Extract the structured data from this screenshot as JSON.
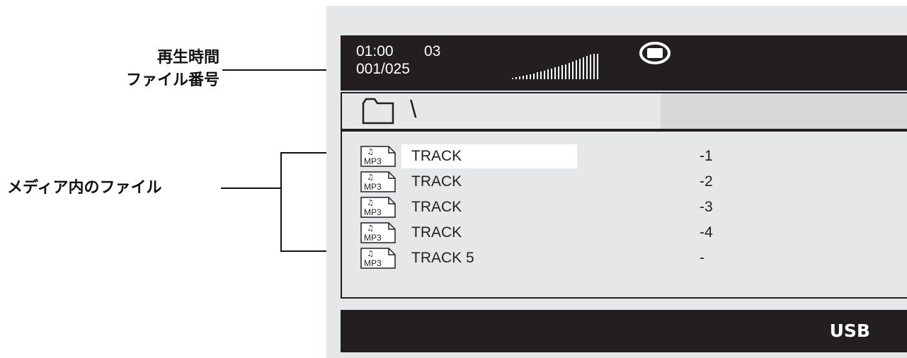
{
  "callouts": {
    "time_label": "再生時間",
    "file_number_label": "ファイル番号",
    "media_files_label": "メディア内のファイル"
  },
  "status": {
    "elapsed_time": "01:00",
    "track_number": "03",
    "file_counter": "001/025",
    "volume_icon": "volume-bars-icon",
    "disc_icon": "disc-mode-icon"
  },
  "path": {
    "folder_icon": "folder-icon",
    "current_path": "\\"
  },
  "files": [
    {
      "name": "TRACK",
      "number": "-1",
      "icon": "mp3-file-icon",
      "selected": true
    },
    {
      "name": "TRACK",
      "number": "-2",
      "icon": "mp3-file-icon",
      "selected": false
    },
    {
      "name": "TRACK",
      "number": "-3",
      "icon": "mp3-file-icon",
      "selected": false
    },
    {
      "name": "TRACK",
      "number": "-4",
      "icon": "mp3-file-icon",
      "selected": false
    },
    {
      "name": "TRACK 5",
      "number": "-",
      "icon": "mp3-file-icon",
      "selected": false
    }
  ],
  "footer": {
    "source": "USB"
  },
  "colors": {
    "screen_bg": "#e6e7e8",
    "bar_bg": "#231f20",
    "highlight": "#ffffff"
  }
}
